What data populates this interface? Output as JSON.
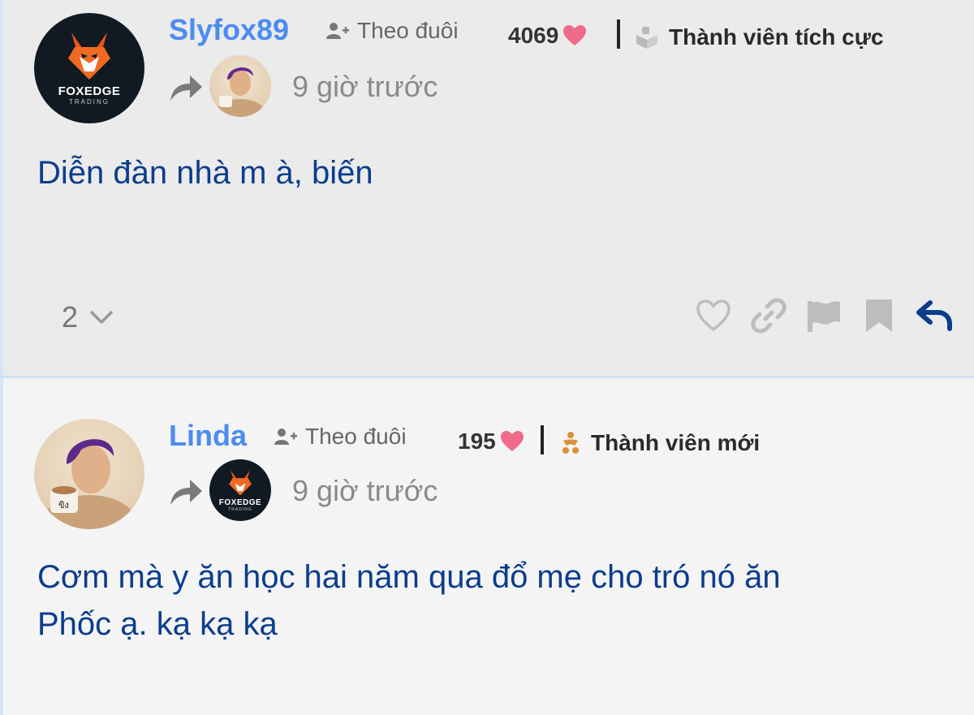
{
  "posts": [
    {
      "username": "Slyfox89",
      "follow_label": "Theo đuôi",
      "like_count": "4069",
      "rank": "Thành viên tích cực",
      "time": "9 giờ trước",
      "content": "Diễn đàn nhà m à, biến",
      "reply_count": "2",
      "avatar": {
        "brand": "FOXEDGE",
        "sub": "TRADING"
      }
    },
    {
      "username": "Linda",
      "follow_label": "Theo đuôi",
      "like_count": "195",
      "rank": "Thành viên mới",
      "time": "9 giờ trước",
      "content_lines": [
        "Cơm mà y ăn học hai năm qua đổ mẹ cho tró nó ăn",
        "Phốc ạ. kạ kạ kạ"
      ],
      "reply_avatar": {
        "brand": "FOXEDGE",
        "sub": "TRADING"
      }
    }
  ],
  "colors": {
    "username": "#4b8cf0",
    "content": "#0b3d8c",
    "heart": "#f06a8a",
    "reply_action": "#0b3d8c"
  },
  "icons": [
    "follow-icon",
    "heart-icon",
    "badge-icon",
    "reply-arrow-icon",
    "like-icon",
    "link-icon",
    "flag-icon",
    "bookmark-icon",
    "reply-icon"
  ]
}
